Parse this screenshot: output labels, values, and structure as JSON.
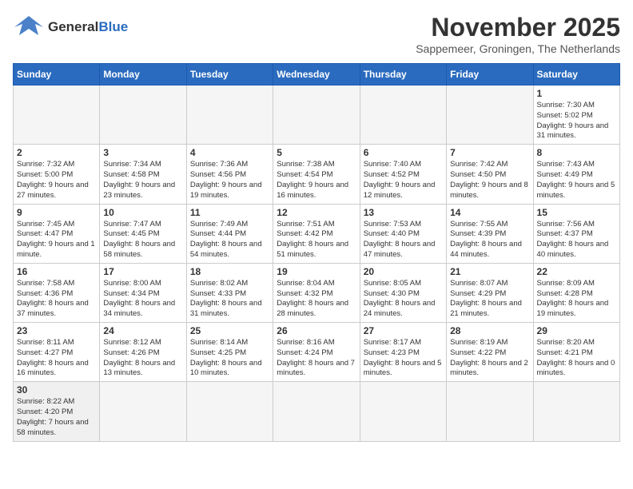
{
  "logo": {
    "general": "General",
    "blue": "Blue",
    "tagline": "GeneralBlue"
  },
  "title": "November 2025",
  "subtitle": "Sappemeer, Groningen, The Netherlands",
  "days_of_week": [
    "Sunday",
    "Monday",
    "Tuesday",
    "Wednesday",
    "Thursday",
    "Friday",
    "Saturday"
  ],
  "weeks": [
    [
      {
        "day": "",
        "info": ""
      },
      {
        "day": "",
        "info": ""
      },
      {
        "day": "",
        "info": ""
      },
      {
        "day": "",
        "info": ""
      },
      {
        "day": "",
        "info": ""
      },
      {
        "day": "",
        "info": ""
      },
      {
        "day": "1",
        "info": "Sunrise: 7:30 AM\nSunset: 5:02 PM\nDaylight: 9 hours and 31 minutes."
      }
    ],
    [
      {
        "day": "2",
        "info": "Sunrise: 7:32 AM\nSunset: 5:00 PM\nDaylight: 9 hours and 27 minutes."
      },
      {
        "day": "3",
        "info": "Sunrise: 7:34 AM\nSunset: 4:58 PM\nDaylight: 9 hours and 23 minutes."
      },
      {
        "day": "4",
        "info": "Sunrise: 7:36 AM\nSunset: 4:56 PM\nDaylight: 9 hours and 19 minutes."
      },
      {
        "day": "5",
        "info": "Sunrise: 7:38 AM\nSunset: 4:54 PM\nDaylight: 9 hours and 16 minutes."
      },
      {
        "day": "6",
        "info": "Sunrise: 7:40 AM\nSunset: 4:52 PM\nDaylight: 9 hours and 12 minutes."
      },
      {
        "day": "7",
        "info": "Sunrise: 7:42 AM\nSunset: 4:50 PM\nDaylight: 9 hours and 8 minutes."
      },
      {
        "day": "8",
        "info": "Sunrise: 7:43 AM\nSunset: 4:49 PM\nDaylight: 9 hours and 5 minutes."
      }
    ],
    [
      {
        "day": "9",
        "info": "Sunrise: 7:45 AM\nSunset: 4:47 PM\nDaylight: 9 hours and 1 minute."
      },
      {
        "day": "10",
        "info": "Sunrise: 7:47 AM\nSunset: 4:45 PM\nDaylight: 8 hours and 58 minutes."
      },
      {
        "day": "11",
        "info": "Sunrise: 7:49 AM\nSunset: 4:44 PM\nDaylight: 8 hours and 54 minutes."
      },
      {
        "day": "12",
        "info": "Sunrise: 7:51 AM\nSunset: 4:42 PM\nDaylight: 8 hours and 51 minutes."
      },
      {
        "day": "13",
        "info": "Sunrise: 7:53 AM\nSunset: 4:40 PM\nDaylight: 8 hours and 47 minutes."
      },
      {
        "day": "14",
        "info": "Sunrise: 7:55 AM\nSunset: 4:39 PM\nDaylight: 8 hours and 44 minutes."
      },
      {
        "day": "15",
        "info": "Sunrise: 7:56 AM\nSunset: 4:37 PM\nDaylight: 8 hours and 40 minutes."
      }
    ],
    [
      {
        "day": "16",
        "info": "Sunrise: 7:58 AM\nSunset: 4:36 PM\nDaylight: 8 hours and 37 minutes."
      },
      {
        "day": "17",
        "info": "Sunrise: 8:00 AM\nSunset: 4:34 PM\nDaylight: 8 hours and 34 minutes."
      },
      {
        "day": "18",
        "info": "Sunrise: 8:02 AM\nSunset: 4:33 PM\nDaylight: 8 hours and 31 minutes."
      },
      {
        "day": "19",
        "info": "Sunrise: 8:04 AM\nSunset: 4:32 PM\nDaylight: 8 hours and 28 minutes."
      },
      {
        "day": "20",
        "info": "Sunrise: 8:05 AM\nSunset: 4:30 PM\nDaylight: 8 hours and 24 minutes."
      },
      {
        "day": "21",
        "info": "Sunrise: 8:07 AM\nSunset: 4:29 PM\nDaylight: 8 hours and 21 minutes."
      },
      {
        "day": "22",
        "info": "Sunrise: 8:09 AM\nSunset: 4:28 PM\nDaylight: 8 hours and 19 minutes."
      }
    ],
    [
      {
        "day": "23",
        "info": "Sunrise: 8:11 AM\nSunset: 4:27 PM\nDaylight: 8 hours and 16 minutes."
      },
      {
        "day": "24",
        "info": "Sunrise: 8:12 AM\nSunset: 4:26 PM\nDaylight: 8 hours and 13 minutes."
      },
      {
        "day": "25",
        "info": "Sunrise: 8:14 AM\nSunset: 4:25 PM\nDaylight: 8 hours and 10 minutes."
      },
      {
        "day": "26",
        "info": "Sunrise: 8:16 AM\nSunset: 4:24 PM\nDaylight: 8 hours and 7 minutes."
      },
      {
        "day": "27",
        "info": "Sunrise: 8:17 AM\nSunset: 4:23 PM\nDaylight: 8 hours and 5 minutes."
      },
      {
        "day": "28",
        "info": "Sunrise: 8:19 AM\nSunset: 4:22 PM\nDaylight: 8 hours and 2 minutes."
      },
      {
        "day": "29",
        "info": "Sunrise: 8:20 AM\nSunset: 4:21 PM\nDaylight: 8 hours and 0 minutes."
      }
    ],
    [
      {
        "day": "30",
        "info": "Sunrise: 8:22 AM\nSunset: 4:20 PM\nDaylight: 7 hours and 58 minutes."
      },
      {
        "day": "",
        "info": ""
      },
      {
        "day": "",
        "info": ""
      },
      {
        "day": "",
        "info": ""
      },
      {
        "day": "",
        "info": ""
      },
      {
        "day": "",
        "info": ""
      },
      {
        "day": "",
        "info": ""
      }
    ]
  ]
}
